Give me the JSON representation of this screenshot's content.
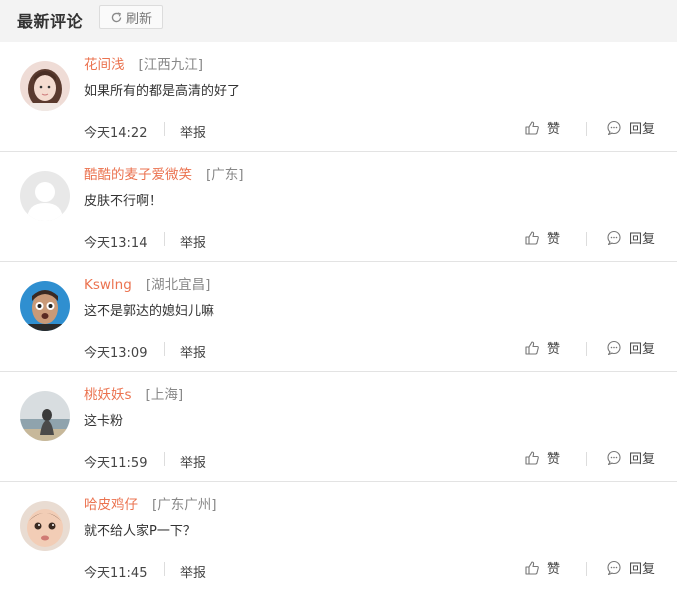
{
  "header": {
    "title": "最新评论",
    "refresh_label": "刷新"
  },
  "comments": [
    {
      "username": "花间浅",
      "location": "[江西九江]",
      "text": "如果所有的都是高清的好了",
      "time": "今天14:22",
      "report": "举报",
      "like": "赞",
      "reply": "回复"
    },
    {
      "username": "酷酷的麦子爱微笑",
      "location": "[广东]",
      "text": "皮肤不行啊！",
      "time": "今天13:14",
      "report": "举报",
      "like": "赞",
      "reply": "回复"
    },
    {
      "username": "Kswlng",
      "location": "[湖北宜昌]",
      "text": "这不是郭达的媳妇儿嘛",
      "time": "今天13:09",
      "report": "举报",
      "like": "赞",
      "reply": "回复"
    },
    {
      "username": "桃妖妖s",
      "location": "[上海]",
      "text": "这卡粉",
      "time": "今天11:59",
      "report": "举报",
      "like": "赞",
      "reply": "回复"
    },
    {
      "username": "哈皮鸡仔",
      "location": "[广东广州]",
      "text": "就不给人家P一下？",
      "time": "今天11:45",
      "report": "举报",
      "like": "赞",
      "reply": "回复"
    }
  ],
  "colors": {
    "username": "#eb7350",
    "location": "#888888",
    "header_bg": "#f3f3f3"
  },
  "icons": {
    "refresh": "refresh-icon",
    "like": "thumbs-up-icon",
    "reply": "speech-bubble-icon"
  }
}
